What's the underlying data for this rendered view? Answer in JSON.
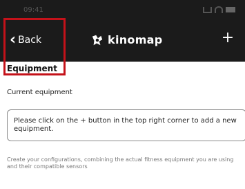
{
  "status_bar": {
    "time": "09:41"
  },
  "nav": {
    "back_label": "Back",
    "brand_name": "kinomap",
    "add_symbol": "+"
  },
  "page": {
    "title": "Equipment",
    "current_heading": "Current equipment",
    "empty_message": "Please click on the + button in the top right corner to add a new equipment.",
    "help_text": "Create your configurations, combining the actual fitness equipment you are using and their compatible sensors"
  },
  "colors": {
    "nav_background": "#1b1b1b",
    "highlight": "#c4121a",
    "text": "#1a1a1a"
  }
}
